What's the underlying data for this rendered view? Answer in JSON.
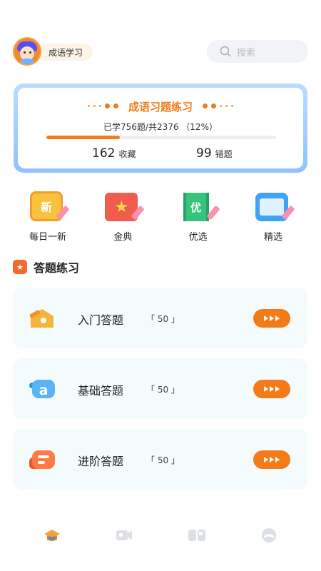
{
  "header": {
    "profile_label": "成语学习",
    "search_placeholder": "搜索"
  },
  "progress_card": {
    "title": "成语习题练习",
    "learned_text": "已学756题/共2376 （12%）",
    "progress_fraction": 0.32,
    "favorites_count": "162",
    "favorites_label": "收藏",
    "errors_count": "99",
    "errors_label": "错题"
  },
  "categories": [
    {
      "label": "每日一新",
      "icon_char": "新",
      "icon": "new-icon"
    },
    {
      "label": "金典",
      "icon_char": "★",
      "icon": "classic-book-icon"
    },
    {
      "label": "优选",
      "icon_char": "优",
      "icon": "best-scroll-icon"
    },
    {
      "label": "精选",
      "icon_char": "",
      "icon": "open-book-icon"
    }
  ],
  "section": {
    "title": "答题练习",
    "icon_char": "★"
  },
  "practice": [
    {
      "title": "入门答题",
      "count": "「 50 」",
      "icon": "house-icon"
    },
    {
      "title": "基础答题",
      "count": "「 50 」",
      "icon": "letter-a-icon"
    },
    {
      "title": "进阶答题",
      "count": "「 50 」",
      "icon": "text-block-icon"
    }
  ],
  "colors": {
    "accent": "#f57a18",
    "card_border": "#8fc2ff",
    "practice_bg": "#f3fbfc"
  }
}
